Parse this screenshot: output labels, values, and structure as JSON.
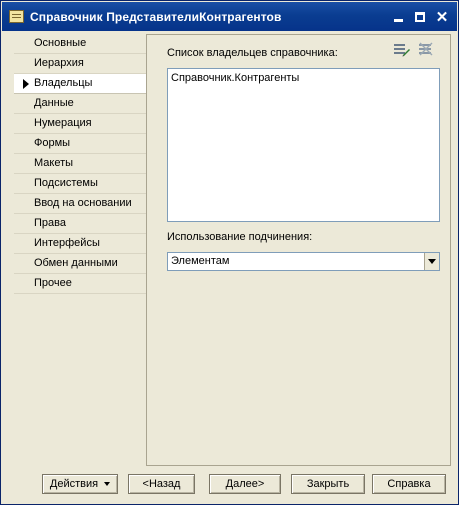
{
  "window": {
    "title": "Справочник ПредставителиКонтрагентов"
  },
  "sidebar": {
    "items": [
      {
        "label": "Основные"
      },
      {
        "label": "Иерархия"
      },
      {
        "label": "Владельцы",
        "active": true
      },
      {
        "label": "Данные"
      },
      {
        "label": "Нумерация"
      },
      {
        "label": "Формы"
      },
      {
        "label": "Макеты"
      },
      {
        "label": "Подсистемы"
      },
      {
        "label": "Ввод на основании"
      },
      {
        "label": "Права"
      },
      {
        "label": "Интерфейсы"
      },
      {
        "label": "Обмен данными"
      },
      {
        "label": "Прочее"
      }
    ]
  },
  "panel": {
    "owners_label": "Список владельцев справочника:",
    "owners": [
      "Справочник.Контрагенты"
    ],
    "subordination_label": "Использование подчинения:",
    "subordination_value": "Элементам",
    "icons": [
      "edit-list-icon",
      "delete-list-icon"
    ]
  },
  "footer": {
    "actions_label": "Действия",
    "back_label": "<Назад",
    "next_label": "Далее>",
    "close_label": "Закрыть",
    "help_label": "Справка"
  }
}
